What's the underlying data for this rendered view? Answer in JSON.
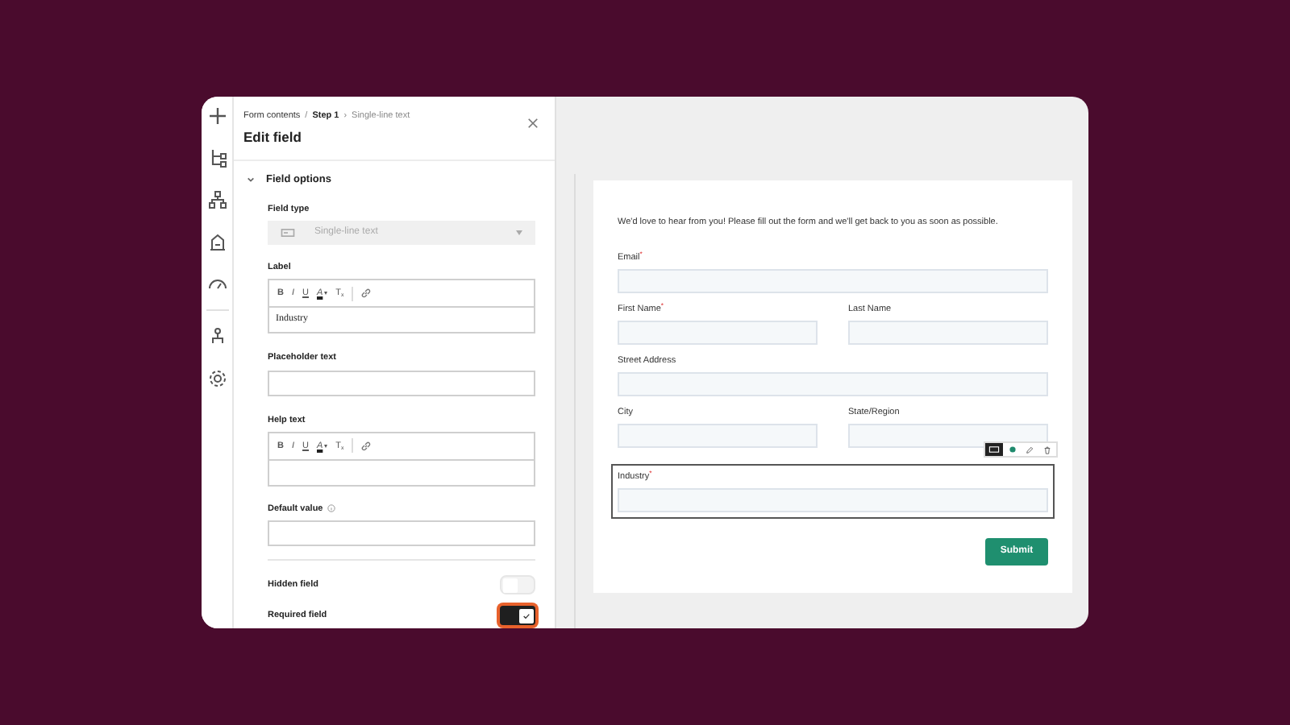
{
  "panel": {
    "breadcrumb": [
      {
        "text": "Form contents",
        "kind": "link"
      },
      {
        "text": "/",
        "kind": "sep"
      },
      {
        "text": "Step 1",
        "kind": "strong"
      },
      {
        "text": "›",
        "kind": "sep"
      },
      {
        "text": "Single-line text",
        "kind": "current"
      }
    ],
    "title": "Edit field",
    "section": {
      "title": "Field options",
      "expanded": true
    },
    "field_type": {
      "label": "Field type",
      "value": "Single-line text",
      "disabled": true
    },
    "label_field": {
      "label": "Label",
      "toolbar": [
        "B",
        "I",
        "U",
        "A",
        "▾",
        "T",
        "x"
      ],
      "value": "Industry"
    },
    "placeholder_field": {
      "label": "Placeholder text"
    },
    "help_field": {
      "label": "Help text",
      "toolbar": [
        "B",
        "I",
        "U",
        "A",
        "▾",
        "T",
        "x"
      ]
    },
    "default_field": {
      "label": "Default value"
    },
    "toggles": [
      {
        "label": "Hidden field",
        "on": false,
        "focused": false
      },
      {
        "label": "Required field",
        "on": true,
        "focused": true
      }
    ]
  },
  "form": {
    "intro": "We'd love to hear from you! Please fill out the form and we'll get back to you as soon as possible.",
    "rows": [
      [
        {
          "label": "Email$^{*}$",
          "selected": false
        }
      ],
      [
        {
          "label": "First Name$^{*}$",
          "selected": false
        },
        {
          "label": "Last Name",
          "selected": false
        }
      ],
      [
        {
          "label": "Street Address",
          "selected": false
        }
      ],
      [
        {
          "label": "City",
          "selected": false
        },
        {
          "label": "State/Region",
          "selected": false
        }
      ],
      [
        {
          "label": "Industry$^{*}$",
          "selected": true
        }
      ]
    ],
    "submit": "Submit"
  }
}
